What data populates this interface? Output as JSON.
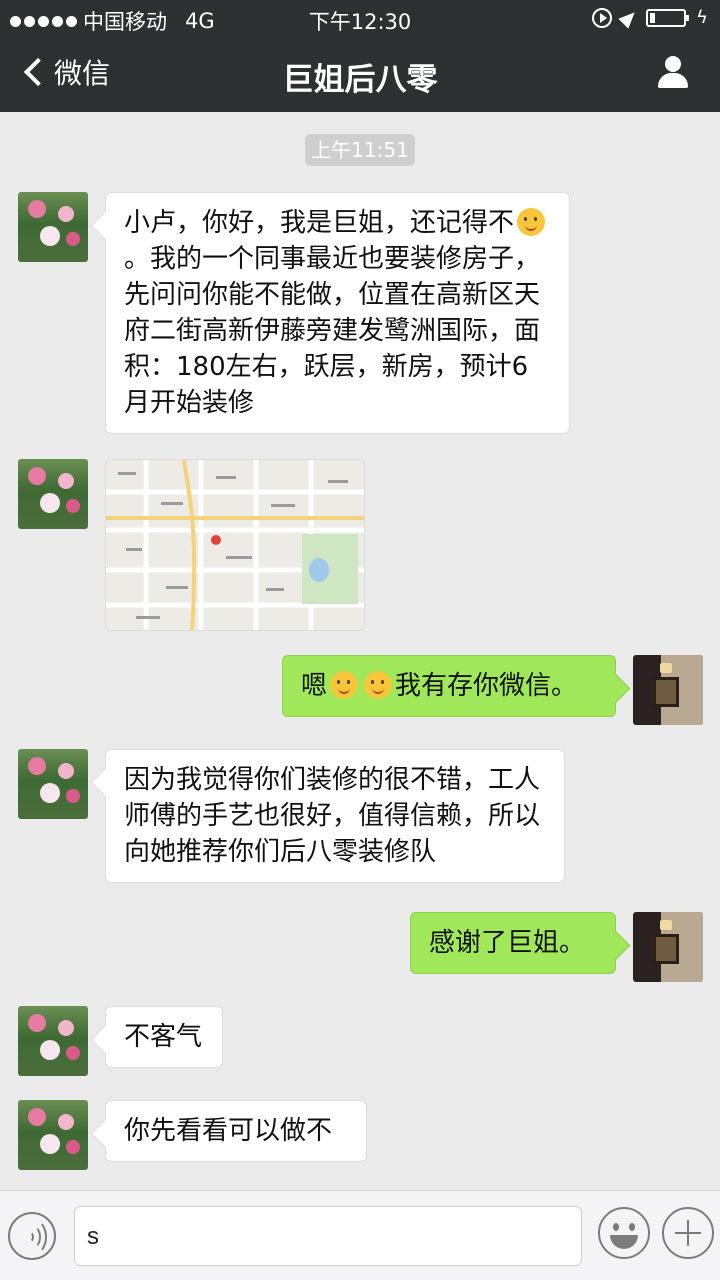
{
  "status_bar": {
    "carrier": "中国移动",
    "network": "4G",
    "time": "下午12:30",
    "battery_level": 0.15
  },
  "nav": {
    "back_label": "微信",
    "title": "巨姐后八零"
  },
  "timestamp": "上午11:51",
  "messages": [
    {
      "sender": "other",
      "line1": "小卢，你好，我是巨姐，还记得不",
      "line2": "。我的一个同事最近也要装修房子，先问问你能不能做，位置在高新区天府二街高新伊藤旁建发鹭洲国际，面积：180左右，跃层，新房，预计6月开始装修"
    },
    {
      "sender": "other",
      "type": "image",
      "icon": "map-icon"
    },
    {
      "sender": "me",
      "prefix": "嗯",
      "suffix": "我有存你微信。"
    },
    {
      "sender": "other",
      "text": "因为我觉得你们装修的很不错，工人师傅的手艺也很好，值得信赖，所以向她推荐你们后八零装修队"
    },
    {
      "sender": "me",
      "text": "感谢了巨姐。"
    },
    {
      "sender": "other",
      "text": "不客气"
    },
    {
      "sender": "other",
      "text": "你先看看可以做不"
    }
  ],
  "input": {
    "value": "s"
  },
  "colors": {
    "nav_bg": "#2e3132",
    "bubble_out": "#a0e75a",
    "bubble_in": "#ffffff",
    "chat_bg": "#ebebeb"
  }
}
